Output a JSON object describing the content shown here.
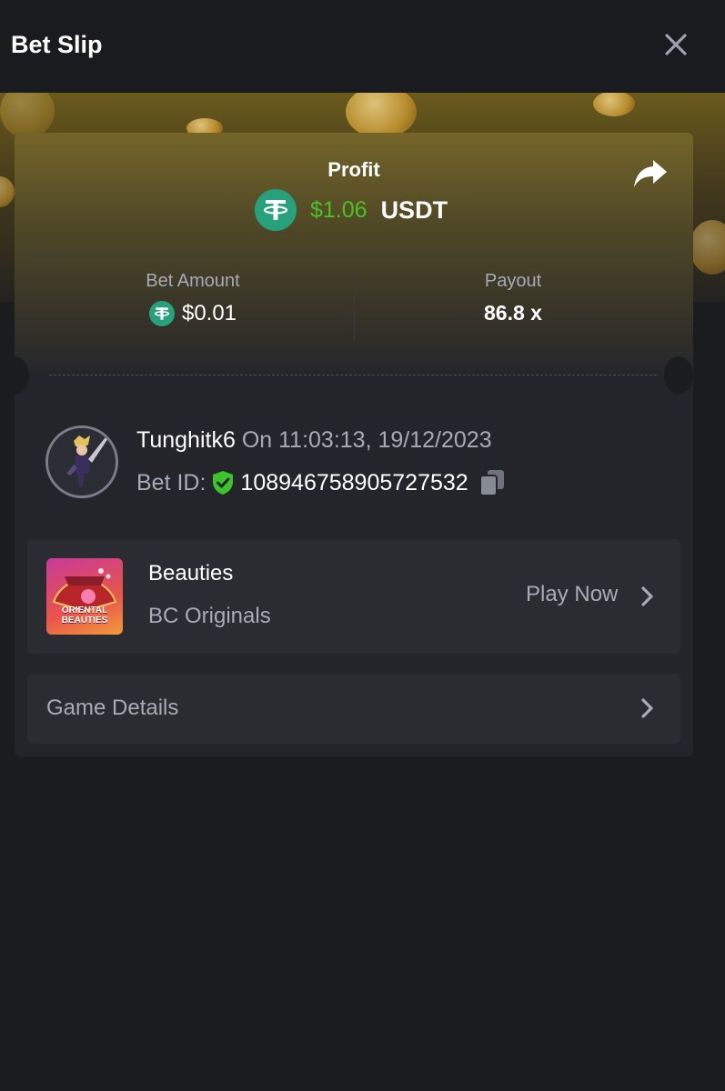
{
  "header": {
    "title": "Bet Slip",
    "close_icon": "close-icon"
  },
  "profit": {
    "label": "Profit",
    "value": "$1.06",
    "currency": "USDT",
    "value_color": "#4bc124"
  },
  "bet_amount": {
    "label": "Bet Amount",
    "value": "$0.01"
  },
  "payout": {
    "label": "Payout",
    "value": "86.8 x"
  },
  "user": {
    "name": "Tunghitk6",
    "date": "On 11:03:13, 19/12/2023",
    "bet_id_label": "Bet ID:",
    "bet_id": "108946758905727532"
  },
  "game": {
    "name": "Beauties",
    "provider": "BC Originals",
    "play_label": "Play Now",
    "thumbnail_text": "ORIENTAL BEAUTIES"
  },
  "details": {
    "label": "Game Details"
  },
  "colors": {
    "background": "#1b1c1e",
    "card": "#24252a",
    "row": "#2b2c32",
    "accent_green": "#4bc124",
    "tether": "#26a17b"
  }
}
